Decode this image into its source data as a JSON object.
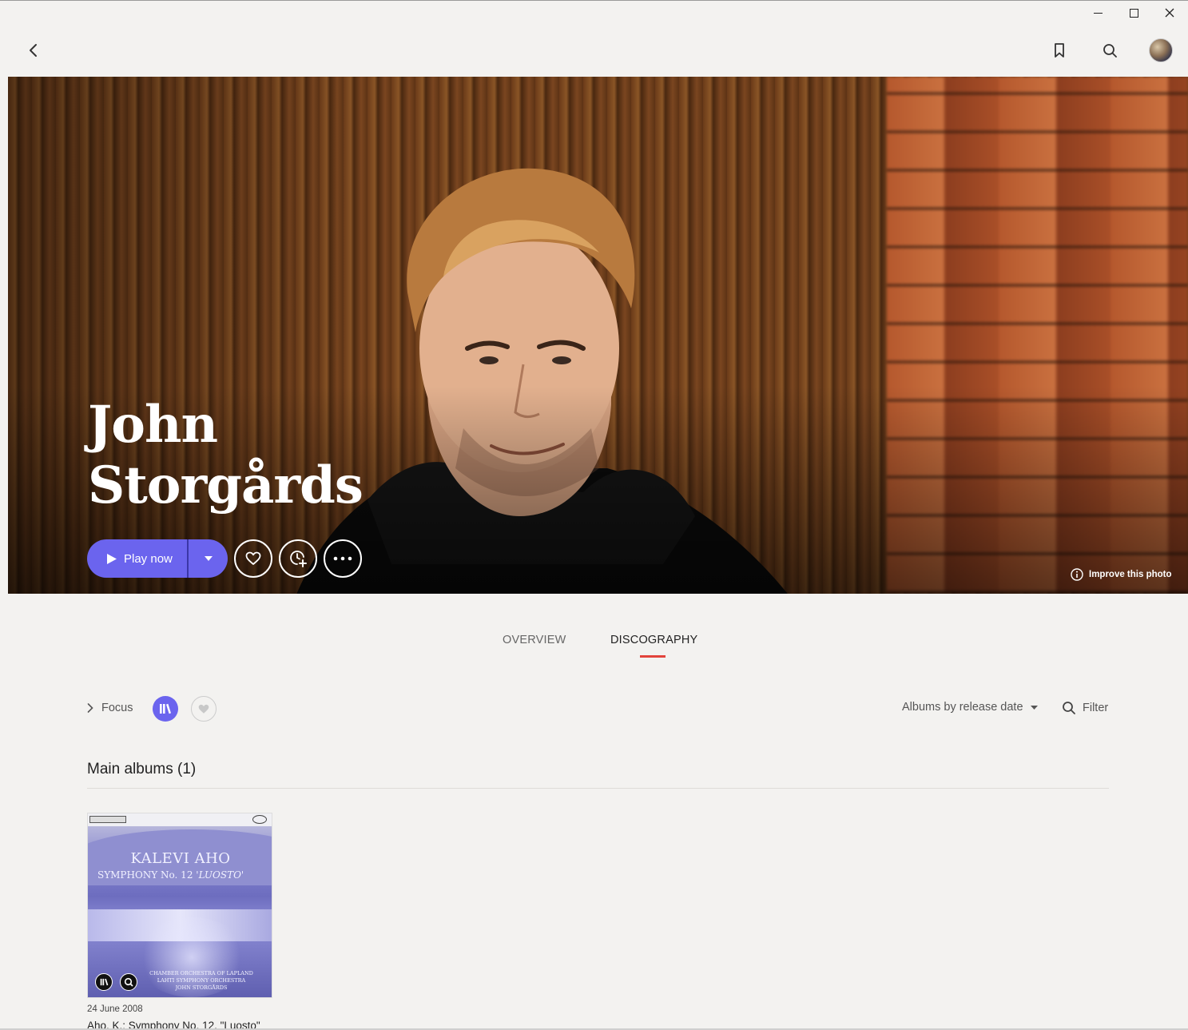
{
  "window": {
    "controls": [
      "minimize",
      "maximize",
      "close"
    ]
  },
  "header": {
    "icons": [
      "back-icon",
      "bookmark-icon",
      "search-icon",
      "avatar"
    ]
  },
  "artist": {
    "name_line1": "John",
    "name_line2": "Storgårds"
  },
  "actions": {
    "play_label": "Play now",
    "improve_photo": "Improve this photo"
  },
  "tabs": [
    {
      "label": "OVERVIEW",
      "active": false
    },
    {
      "label": "DISCOGRAPHY",
      "active": true
    }
  ],
  "filters": {
    "focus_label": "Focus",
    "sort_label": "Albums by release date",
    "filter_label": "Filter"
  },
  "section": {
    "title": "Main albums (1)"
  },
  "albums": [
    {
      "cover_title": "KALEVI AHO",
      "cover_subtitle": "SYMPHONY No. 12",
      "cover_subtitle_italic": "'LUOSTO'",
      "cover_credits": [
        "CHAMBER ORCHESTRA OF LAPLAND",
        "LAHTI SYMPHONY ORCHESTRA",
        "JOHN STORGÅRDS"
      ],
      "date": "24 June 2008",
      "title": "Aho, K.: Symphony No. 12, \"Luosto\""
    }
  ],
  "colors": {
    "accent": "#6b64ee",
    "tab_underline": "#e2433b",
    "background": "#f3f2f0"
  }
}
